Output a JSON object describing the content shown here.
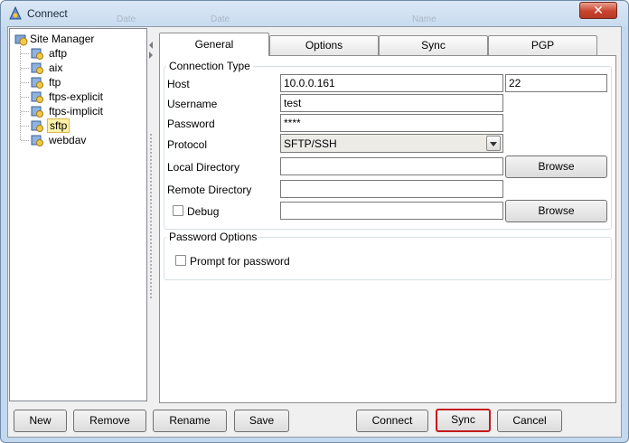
{
  "window": {
    "title": "Connect",
    "close_label": "✕"
  },
  "ghost_headers": [
    "Date",
    "Date",
    "Name"
  ],
  "tree": {
    "root": "Site Manager",
    "items": [
      {
        "label": "aftp",
        "selected": false
      },
      {
        "label": "aix",
        "selected": false
      },
      {
        "label": "ftp",
        "selected": false
      },
      {
        "label": "ftps-explicit",
        "selected": false
      },
      {
        "label": "ftps-implicit",
        "selected": false
      },
      {
        "label": "sftp",
        "selected": true
      },
      {
        "label": "webdav",
        "selected": false
      }
    ]
  },
  "tabs": [
    "General",
    "Options",
    "Sync",
    "PGP"
  ],
  "active_tab": "General",
  "connection_type": {
    "title": "Connection Type",
    "host_label": "Host",
    "host_value": "10.0.0.161",
    "port_value": "22",
    "username_label": "Username",
    "username_value": "test",
    "password_label": "Password",
    "password_value": "****",
    "protocol_label": "Protocol",
    "protocol_value": "SFTP/SSH",
    "local_dir_label": "Local Directory",
    "local_dir_value": "",
    "remote_dir_label": "Remote Directory",
    "remote_dir_value": "",
    "debug_label": "Debug",
    "debug_checked": false,
    "debug_value": "",
    "browse_label": "Browse"
  },
  "password_options": {
    "title": "Password Options",
    "prompt_label": "Prompt for password",
    "prompt_checked": false
  },
  "bottom_buttons": {
    "new": "New",
    "remove": "Remove",
    "rename": "Rename",
    "save": "Save",
    "connect": "Connect",
    "sync": "Sync",
    "cancel": "Cancel"
  },
  "colors": {
    "title_bar": "#c7dbef",
    "close_button": "#c8442f",
    "focus_border": "#c41a1a",
    "selection_bg": "#fff2a8"
  }
}
